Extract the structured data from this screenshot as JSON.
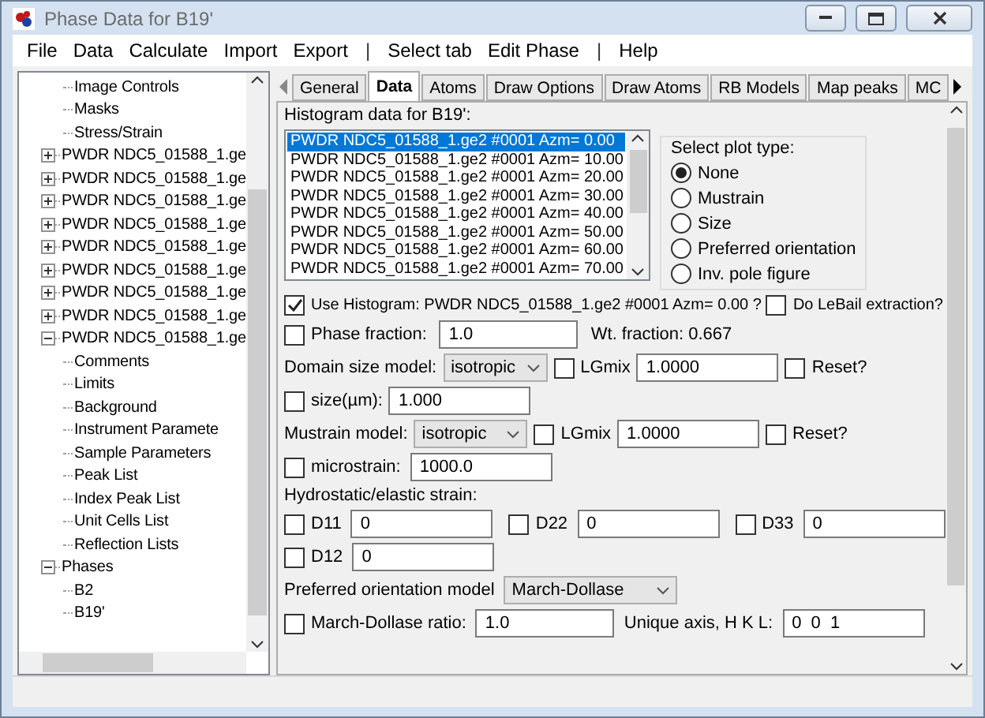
{
  "window": {
    "title": "Phase Data for B19'"
  },
  "menu": [
    {
      "label": "File",
      "kind": "item"
    },
    {
      "label": "Data",
      "kind": "item"
    },
    {
      "label": "Calculate",
      "kind": "item"
    },
    {
      "label": "Import",
      "kind": "item"
    },
    {
      "label": "Export",
      "kind": "item"
    },
    {
      "label": "|",
      "kind": "separator"
    },
    {
      "label": "Select tab",
      "kind": "item"
    },
    {
      "label": "Edit Phase",
      "kind": "item"
    },
    {
      "label": "|",
      "kind": "separator"
    },
    {
      "label": "Help",
      "kind": "item"
    }
  ],
  "tree": {
    "cut_branch": [
      "Image Controls",
      "Masks",
      "Stress/Strain"
    ],
    "items": [
      {
        "label": "PWDR NDC5_01588_1.ge",
        "expanded": false
      },
      {
        "label": "PWDR NDC5_01588_1.ge",
        "expanded": false
      },
      {
        "label": "PWDR NDC5_01588_1.ge",
        "expanded": false
      },
      {
        "label": "PWDR NDC5_01588_1.ge",
        "expanded": false
      },
      {
        "label": "PWDR NDC5_01588_1.ge",
        "expanded": false
      },
      {
        "label": "PWDR NDC5_01588_1.ge",
        "expanded": false
      },
      {
        "label": "PWDR NDC5_01588_1.ge",
        "expanded": false
      },
      {
        "label": "PWDR NDC5_01588_1.ge",
        "expanded": false
      },
      {
        "label": "PWDR NDC5_01588_1.ge",
        "expanded": true,
        "children": [
          {
            "label": "Comments"
          },
          {
            "label": "Limits"
          },
          {
            "label": "Background"
          },
          {
            "label": "Instrument Paramete"
          },
          {
            "label": "Sample Parameters"
          },
          {
            "label": "Peak List"
          },
          {
            "label": "Index Peak List"
          },
          {
            "label": "Unit Cells List"
          },
          {
            "label": "Reflection Lists"
          }
        ]
      },
      {
        "label": "Phases",
        "expanded": true,
        "children": [
          {
            "label": "B2"
          },
          {
            "label": "B19'"
          }
        ]
      }
    ]
  },
  "tabs": [
    {
      "label": "General",
      "selected": false
    },
    {
      "label": "Data",
      "selected": true
    },
    {
      "label": "Atoms",
      "selected": false
    },
    {
      "label": "Draw Options",
      "selected": false
    },
    {
      "label": "Draw Atoms",
      "selected": false
    },
    {
      "label": "RB Models",
      "selected": false
    },
    {
      "label": "Map peaks",
      "selected": false
    },
    {
      "label": "MC",
      "selected": false
    }
  ],
  "data_tab": {
    "heading": "Histogram data for B19':",
    "histograms": [
      {
        "label": "PWDR NDC5_01588_1.ge2 #0001 Azm= 0.00",
        "selected": true
      },
      {
        "label": "PWDR NDC5_01588_1.ge2 #0001 Azm= 10.00",
        "selected": false
      },
      {
        "label": "PWDR NDC5_01588_1.ge2 #0001 Azm= 20.00",
        "selected": false
      },
      {
        "label": "PWDR NDC5_01588_1.ge2 #0001 Azm= 30.00",
        "selected": false
      },
      {
        "label": "PWDR NDC5_01588_1.ge2 #0001 Azm= 40.00",
        "selected": false
      },
      {
        "label": "PWDR NDC5_01588_1.ge2 #0001 Azm= 50.00",
        "selected": false
      },
      {
        "label": "PWDR NDC5_01588_1.ge2 #0001 Azm= 60.00",
        "selected": false
      },
      {
        "label": "PWDR NDC5_01588_1.ge2 #0001 Azm= 70.00",
        "selected": false
      }
    ],
    "plot_type": {
      "title": "Select plot type:",
      "options": [
        {
          "label": "None",
          "selected": true
        },
        {
          "label": "Mustrain",
          "selected": false
        },
        {
          "label": "Size",
          "selected": false
        },
        {
          "label": "Preferred orientation",
          "selected": false
        },
        {
          "label": "Inv. pole figure",
          "selected": false
        }
      ]
    },
    "use_histogram": {
      "label": "Use Histogram: PWDR NDC5_01588_1.ge2 #0001 Azm= 0.00 ?",
      "checked": true
    },
    "lebail": {
      "label": "Do LeBail extraction?",
      "checked": false
    },
    "phase_fraction": {
      "label": "Phase fraction:",
      "checked": false,
      "value": "1.0",
      "wt_fraction": "Wt. fraction: 0.667"
    },
    "domain_size": {
      "label": "Domain size model:",
      "model": "isotropic",
      "lgmix": {
        "label": "LGmix",
        "checked": false,
        "value": "1.0000"
      },
      "reset": {
        "label": "Reset?",
        "checked": false
      }
    },
    "size": {
      "label": "size(µm):",
      "checked": false,
      "value": "1.000"
    },
    "mustrain": {
      "label": "Mustrain model:",
      "model": "isotropic",
      "lgmix": {
        "label": "LGmix",
        "checked": false,
        "value": "1.0000"
      },
      "reset": {
        "label": "Reset?",
        "checked": false
      }
    },
    "microstrain": {
      "label": "microstrain:",
      "checked": false,
      "value": "1000.0"
    },
    "hydrostatic": {
      "title": "Hydrostatic/elastic strain:",
      "rows": [
        [
          {
            "label": "D11",
            "checked": false,
            "value": "0"
          },
          {
            "label": "D22",
            "checked": false,
            "value": "0"
          },
          {
            "label": "D33",
            "checked": false,
            "value": "0"
          }
        ],
        [
          {
            "label": "D12",
            "checked": false,
            "value": "0"
          }
        ]
      ]
    },
    "preferred_orientation": {
      "label": "Preferred orientation model",
      "model": "March-Dollase"
    },
    "march_dollase": {
      "label": "March-Dollase ratio:",
      "checked": false,
      "value": "1.0",
      "axis_label": "Unique axis, H K L:",
      "axis_value": "0  0  1"
    }
  }
}
